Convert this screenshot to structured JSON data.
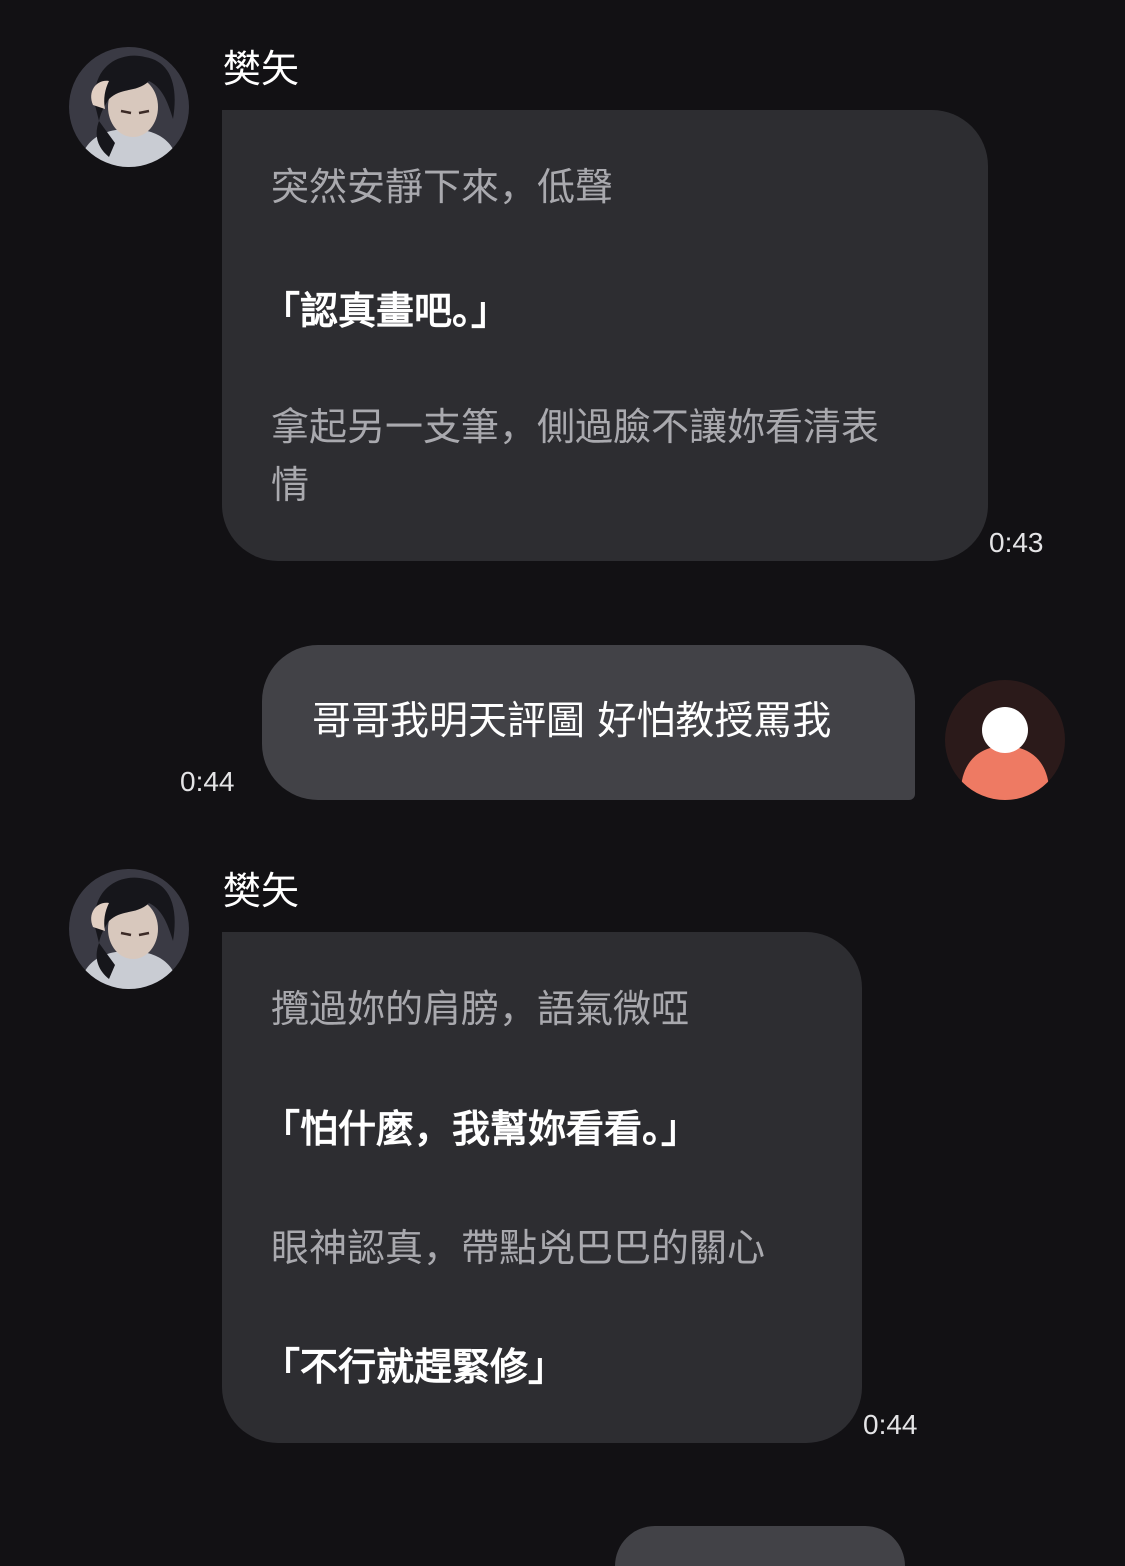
{
  "colors": {
    "background": "#121114",
    "bot_bubble": "#2d2d31",
    "user_bubble": "#424247",
    "narration_text": "#a9a9ae",
    "speech_text": "#ffffff",
    "user_avatar_bg": "#2b1a1a",
    "user_avatar_accent": "#ee7a63"
  },
  "messages": [
    {
      "role": "character",
      "sender": "樊矢",
      "avatar_icon": "character-portrait-avatar",
      "lines": [
        {
          "type": "narration",
          "text": "突然安靜下來，低聲"
        },
        {
          "type": "speech",
          "text": "「認真畫吧。」"
        },
        {
          "type": "narration",
          "text": "拿起另一支筆，側過臉不讓妳看清表"
        },
        {
          "type": "narration",
          "text": "情"
        }
      ],
      "time": "0:43"
    },
    {
      "role": "user",
      "avatar_icon": "default-user-avatar",
      "text": "哥哥我明天評圖 好怕教授罵我",
      "time": "0:44"
    },
    {
      "role": "character",
      "sender": "樊矢",
      "avatar_icon": "character-portrait-avatar",
      "lines": [
        {
          "type": "narration",
          "text": "攬過妳的肩膀，語氣微啞"
        },
        {
          "type": "speech",
          "text": "「怕什麼，我幫妳看看。」"
        },
        {
          "type": "narration",
          "text": "眼神認真，帶點兇巴巴的關心"
        },
        {
          "type": "speech",
          "text": "「不行就趕緊修」"
        }
      ],
      "time": "0:44"
    }
  ]
}
